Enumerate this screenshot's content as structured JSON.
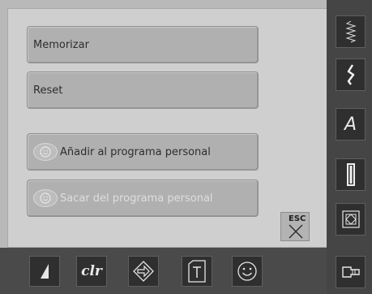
{
  "menu": {
    "memorize_label": "Memorizar",
    "reset_label": "Reset",
    "add_personal_label": "Añadir al programa personal",
    "remove_personal_label": "Sacar del programa personal"
  },
  "esc_label": "ESC",
  "bottom_bar": {
    "clr_label": "clr"
  },
  "side_bar": {
    "alphabet_label": "A"
  }
}
